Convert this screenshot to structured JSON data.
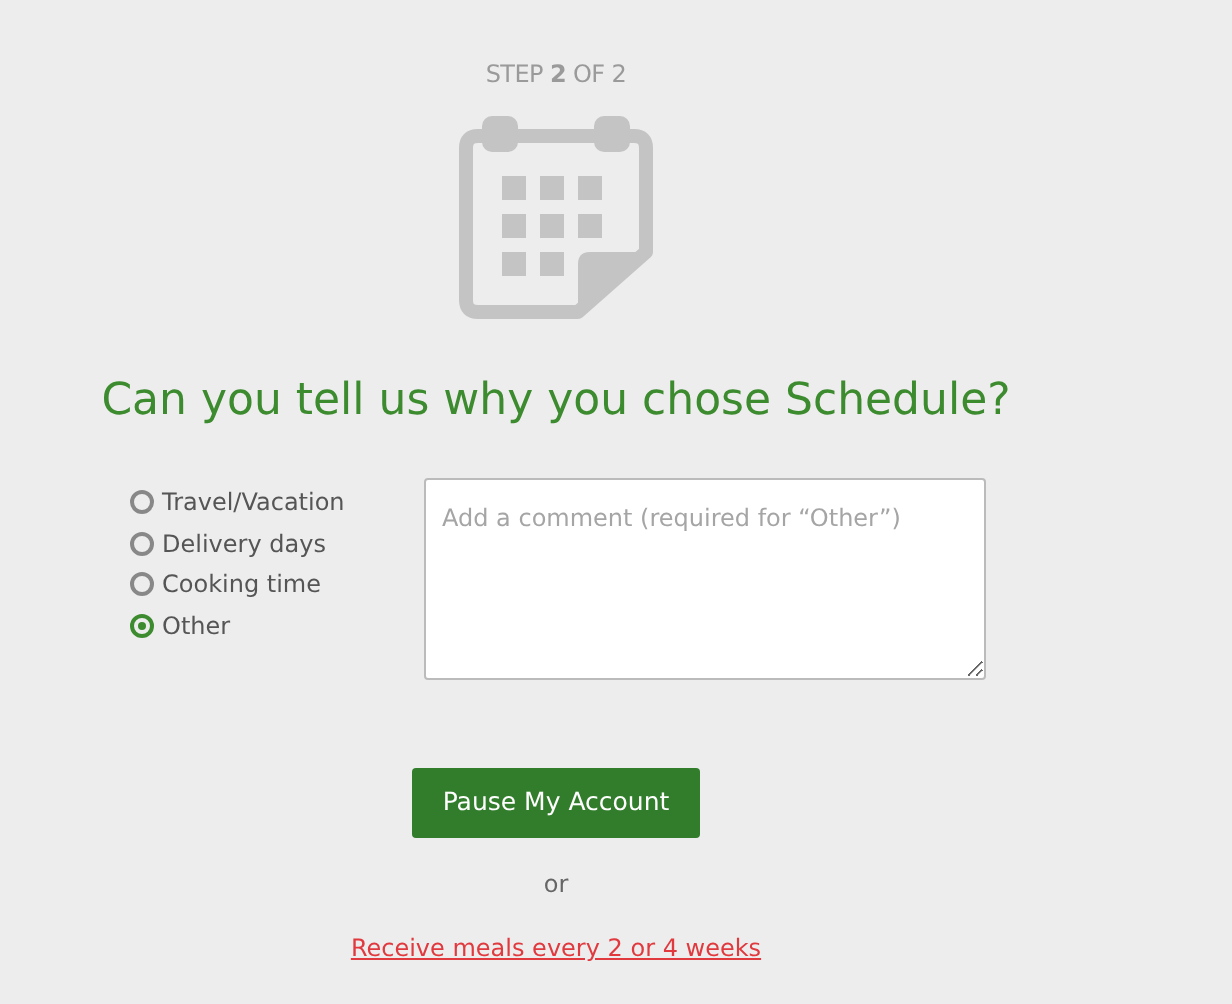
{
  "step": "STEP **2** OF 2",
  "heading": "Can you tell us why you chose Schedule?",
  "reasons": [
    {
      "label": "Travel/Vacation",
      "selected": false
    },
    {
      "label": "Delivery days",
      "selected": false
    },
    {
      "label": "Cooking time",
      "selected": false
    },
    {
      "label": "Other",
      "selected": true
    }
  ],
  "comment": {
    "placeholder": "Add a comment (required for “Other”)"
  },
  "primary_button": "Pause My Account",
  "separator": "or",
  "alt_link": "Receive meals every 2 or 4 weeks"
}
